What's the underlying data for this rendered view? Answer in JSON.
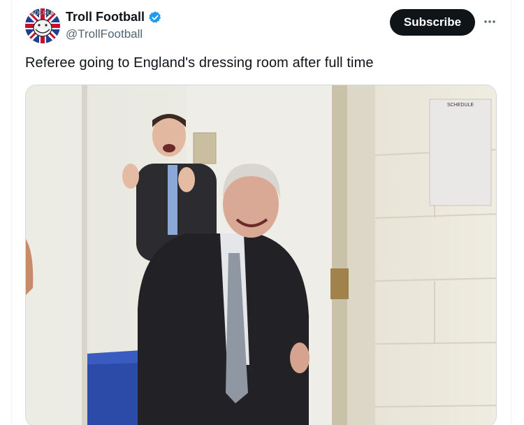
{
  "tweet": {
    "author": {
      "display_name": "Troll Football",
      "handle": "@TrollFootball",
      "verified": true,
      "avatar_icon": "troll-face-union-jack-avatar",
      "avatar_text": "SOCCER"
    },
    "subscribe_label": "Subscribe",
    "more_icon": "ellipsis-icon",
    "text": "Referee going to England's dressing room after full time",
    "media": {
      "type": "video-still",
      "door_sign_text": "SCHEDULE"
    }
  },
  "colors": {
    "text_primary": "#0f1419",
    "text_secondary": "#536471",
    "verified_blue": "#1d9bf0",
    "subscribe_bg": "#0f1419",
    "border": "#cfd9de"
  }
}
